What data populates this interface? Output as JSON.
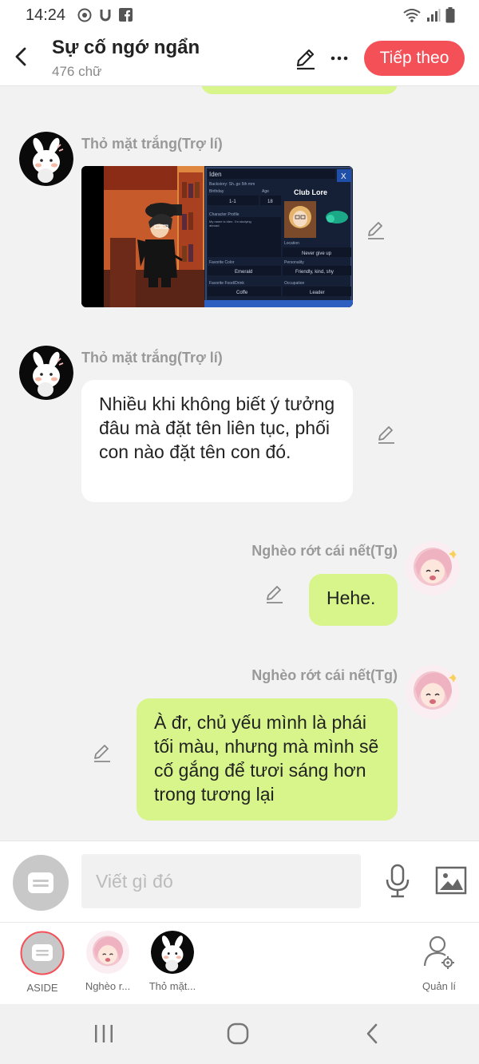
{
  "status": {
    "time": "14:24"
  },
  "header": {
    "title": "Sự cố ngớ ngẩn",
    "word_count": "476 chữ",
    "next_label": "Tiếp theo"
  },
  "messages": [
    {
      "sender": "Thỏ mặt trắng(Trợ lí)",
      "type": "image",
      "side": "left",
      "image_text": {
        "panel_title": "Iden",
        "lore_label": "ClubLore",
        "birthday_value": "1-1",
        "age_value": "18",
        "location_value": "Never give up",
        "personality_value": "Friendly, kind, shy",
        "color_value": "Emerald",
        "drink_value": "Coffe",
        "job_value": "Leader"
      }
    },
    {
      "sender": "Thỏ mặt trắng(Trợ lí)",
      "type": "text",
      "side": "left",
      "text": "Nhiều khi không biết ý tưởng đâu mà đặt tên liên tục, phối con nào đặt tên con đó."
    },
    {
      "sender": "Nghèo rớt cái nết(Tg)",
      "type": "text",
      "side": "right",
      "text": "Hehe."
    },
    {
      "sender": "Nghèo rớt cái nết(Tg)",
      "type": "text",
      "side": "right",
      "text": "À đr, chủ yếu mình là phái tối màu, nhưng mà mình sẽ cố gắng để tươi sáng hơn trong tương lại"
    }
  ],
  "composer": {
    "placeholder": "Viết gì đó"
  },
  "roles": [
    {
      "label": "ASIDE"
    },
    {
      "label": "Nghèo r..."
    },
    {
      "label": "Thỏ mặt..."
    },
    {
      "label": "Quản lí"
    }
  ],
  "colors": {
    "accent": "#f45058",
    "right_bubble": "#d7f58a",
    "left_bubble": "#ffffff",
    "background": "#f2f2f2"
  }
}
